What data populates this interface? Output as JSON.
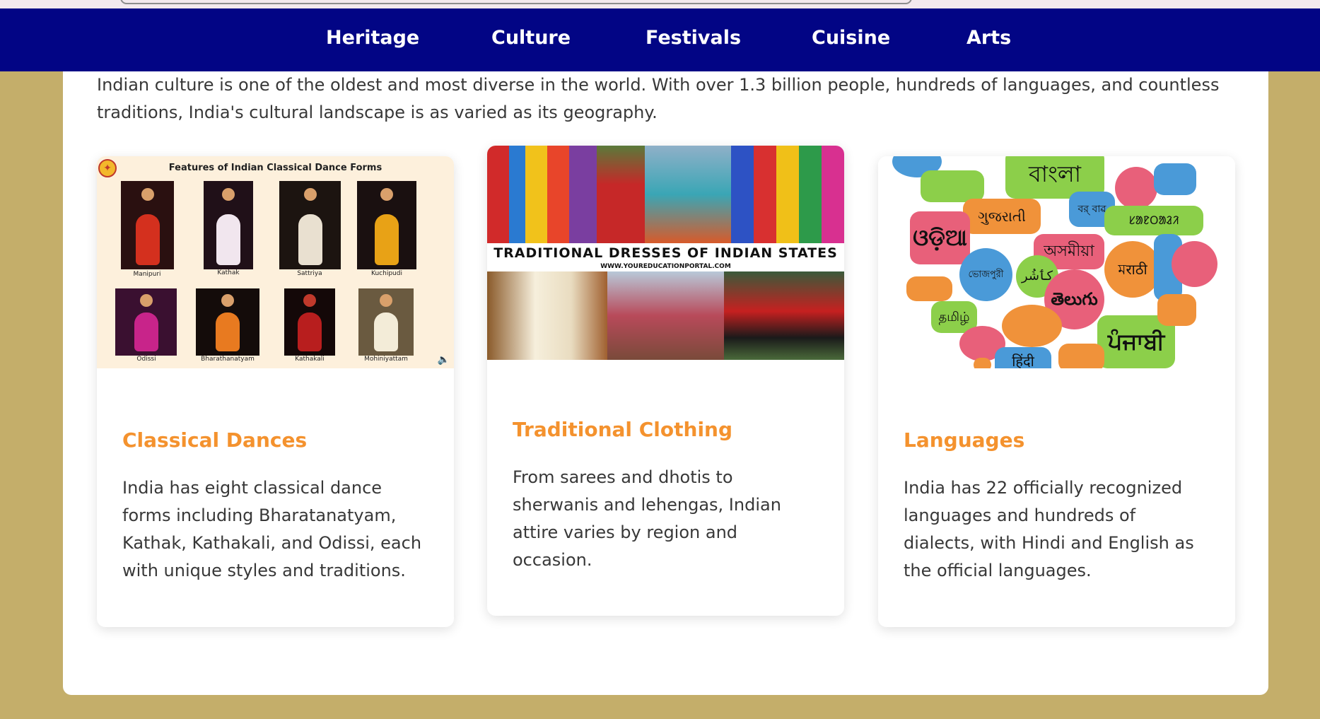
{
  "nav": {
    "items": [
      "Heritage",
      "Culture",
      "Festivals",
      "Cuisine",
      "Arts"
    ]
  },
  "intro": "Indian culture is one of the oldest and most diverse in the world. With over 1.3 billion people, hundreds of languages, and countless traditions, India's cultural landscape is as varied as its geography.",
  "cards": [
    {
      "title": "Classical Dances",
      "text": "India has eight classical dance forms including Bharatanatyam, Kathak, Kathakali, and Odissi, each with unique styles and traditions.",
      "image": {
        "heading": "Features of Indian Classical Dance Forms",
        "labels": [
          "Manipuri",
          "Kathak",
          "Sattriya",
          "Kuchipudi",
          "Odissi",
          "Bharathanatyam",
          "Kathakali",
          "Mohiniyattam"
        ]
      }
    },
    {
      "title": "Traditional Clothing",
      "text": "From sarees and dhotis to sherwanis and lehengas, Indian attire varies by region and occasion.",
      "image": {
        "banner": "TRADITIONAL DRESSES OF INDIAN STATES",
        "source": "WWW.YOUREDUCATIONPORTAL.COM"
      }
    },
    {
      "title": "Languages",
      "text": "India has 22 officially recognized languages and hundreds of dialects, with Hindi and English as the official languages.",
      "image": {
        "words": [
          "বাংলা",
          "ગુજરાતી",
          "ଓଡ଼ିଆ",
          "বর্ বাৱ",
          "ᱥᱟᱱᱛᱟᱲᱤ",
          "অসমীয়া",
          "মराठी",
          "ভোজপুরী",
          "کٲشُر",
          "తెలుగు",
          "தமிழ்",
          "ਪੰਜਾਬੀ",
          "हिंदी"
        ]
      }
    }
  ],
  "colors": {
    "navbar": "#020585",
    "page_bg": "#c4ae6a",
    "card_title": "#f4922e",
    "text": "#383838"
  }
}
